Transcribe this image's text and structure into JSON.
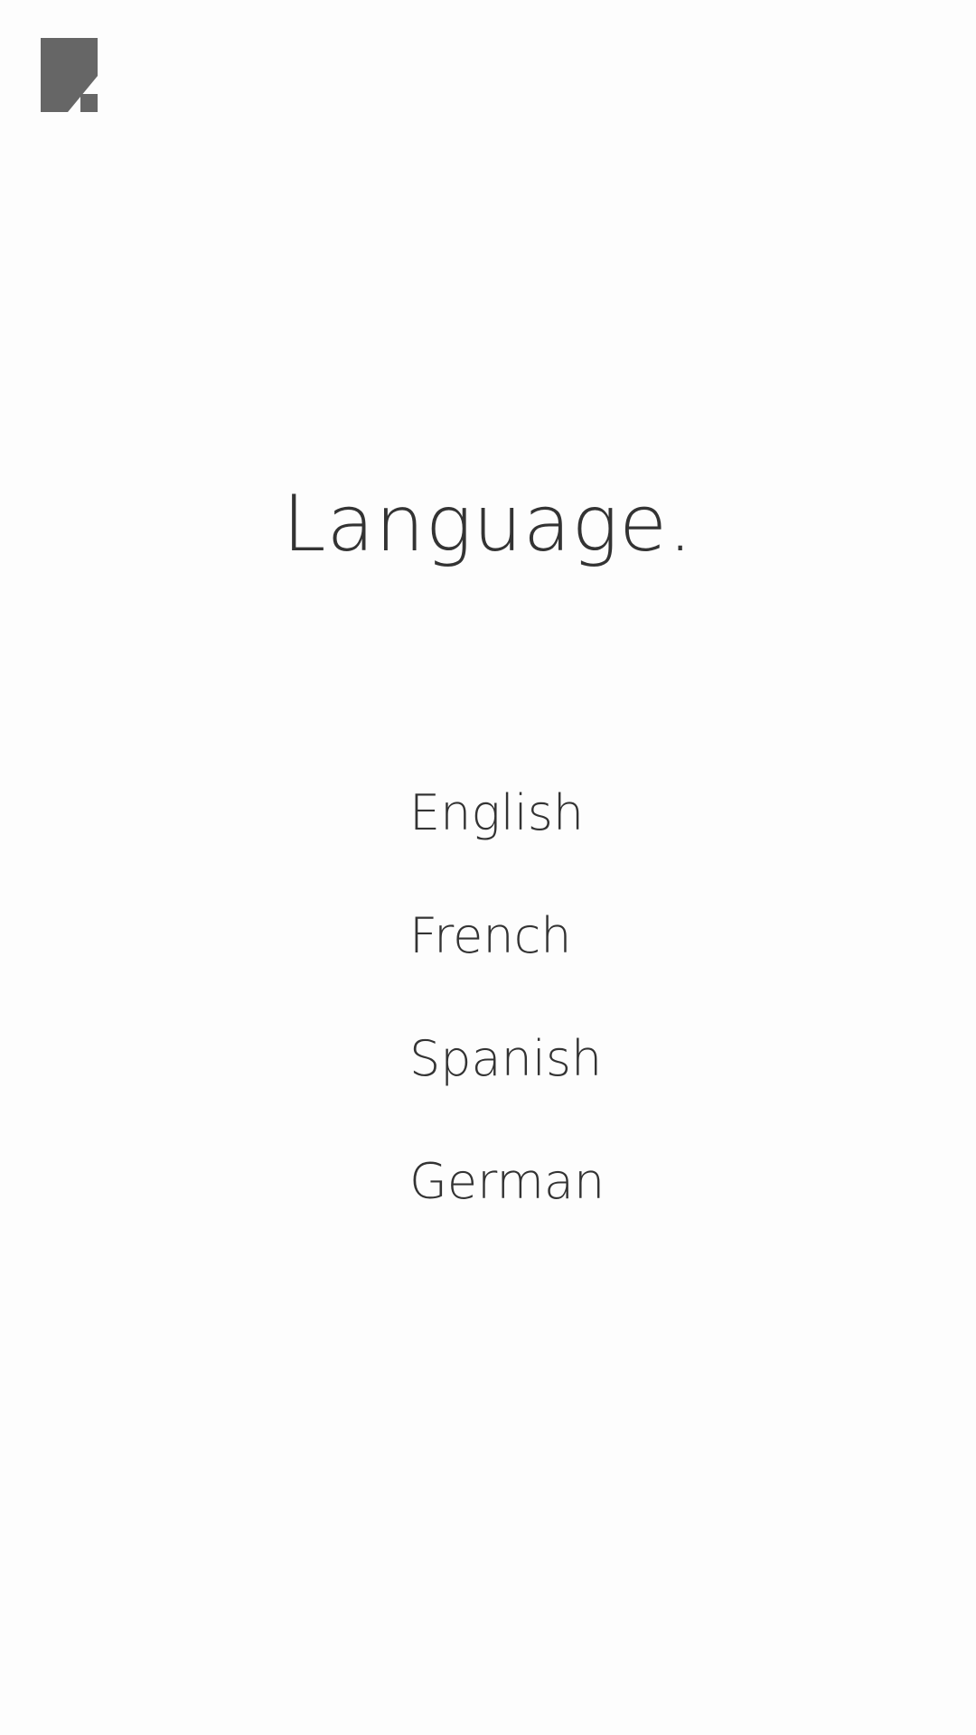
{
  "app": {
    "logo_icon": "bookmark-logo-icon",
    "logo_color": "#666666"
  },
  "main": {
    "title": "Language.",
    "languages": [
      {
        "label": "English"
      },
      {
        "label": "French"
      },
      {
        "label": "Spanish"
      },
      {
        "label": "German"
      }
    ]
  },
  "colors": {
    "background": "#fdfdfd",
    "text": "#333333"
  }
}
